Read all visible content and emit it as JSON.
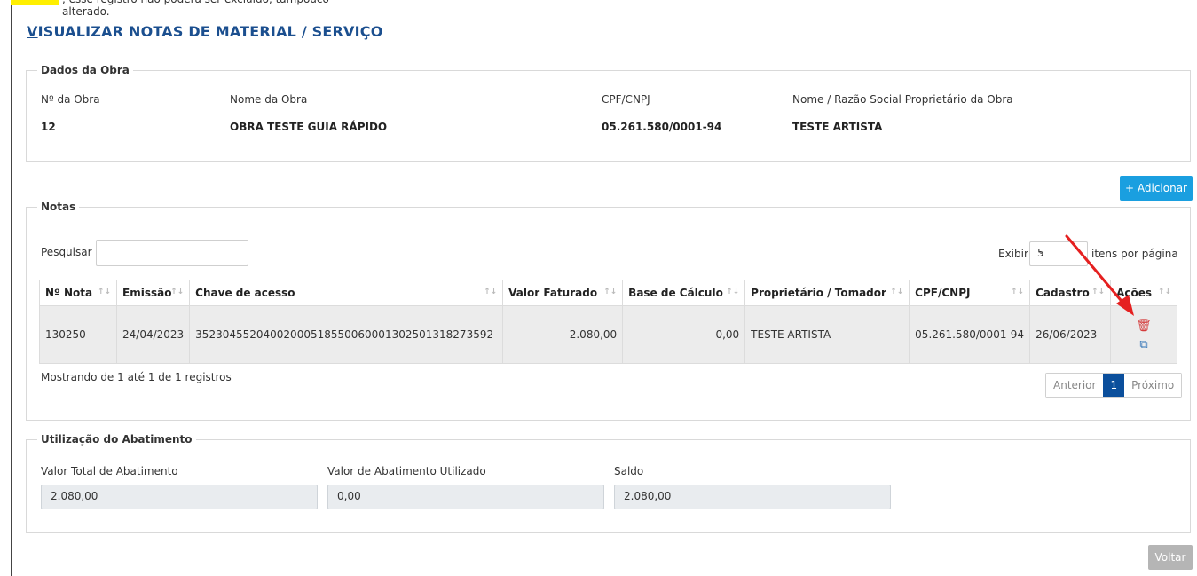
{
  "top_fragment": ", esse registro não poderá ser excluído, tampouco alterado.",
  "page_title_first": "V",
  "page_title_rest": "ISUALIZAR NOTAS DE MATERIAL / SERVIÇO",
  "obra": {
    "legend": "Dados da Obra",
    "labels": [
      "Nº da Obra",
      "Nome da Obra",
      "CPF/CNPJ",
      "Nome / Razão Social Proprietário da Obra"
    ],
    "values": [
      "12",
      "OBRA TESTE GUIA RÁPIDO",
      "05.261.580/0001-94",
      "TESTE ARTISTA"
    ]
  },
  "add_button": "+ Adicionar",
  "notas": {
    "legend": "Notas",
    "search_label": "Pesquisar",
    "search_value": "",
    "show_label": "Exibir",
    "per_page": "5",
    "per_page_suffix": "itens por página",
    "columns": [
      "Nº Nota",
      "Emissão",
      "Chave de acesso",
      "Valor Faturado",
      "Base de Cálculo",
      "Proprietário / Tomador",
      "CPF/CNPJ",
      "Cadastro",
      "Ações"
    ],
    "rows": [
      [
        "130250",
        "24/04/2023",
        "35230455204002000518550060001302501318273592",
        "2.080,00",
        "0,00",
        "TESTE ARTISTA",
        "05.261.580/0001-94",
        "26/06/2023"
      ]
    ],
    "info": "Mostrando de 1 até 1 de 1 registros",
    "prev": "Anterior",
    "page": "1",
    "next": "Próximo"
  },
  "abatimento": {
    "legend": "Utilização do Abatimento",
    "labels": [
      "Valor Total de Abatimento",
      "Valor de Abatimento Utilizado",
      "Saldo"
    ],
    "values": [
      "2.080,00",
      "0,00",
      "2.080,00"
    ]
  },
  "back_button": "Voltar",
  "icons": {
    "delete": "trash-icon",
    "copy": "copy-icon",
    "sort": "sort-icon",
    "annotation": "red-arrow"
  },
  "colors": {
    "title": "#1b4f8f",
    "add_button": "#1a9fe0",
    "active_page": "#0b4f9c",
    "delete_icon": "#d43a3a",
    "arrow": "#e52020",
    "highlight": "#ffef00"
  }
}
